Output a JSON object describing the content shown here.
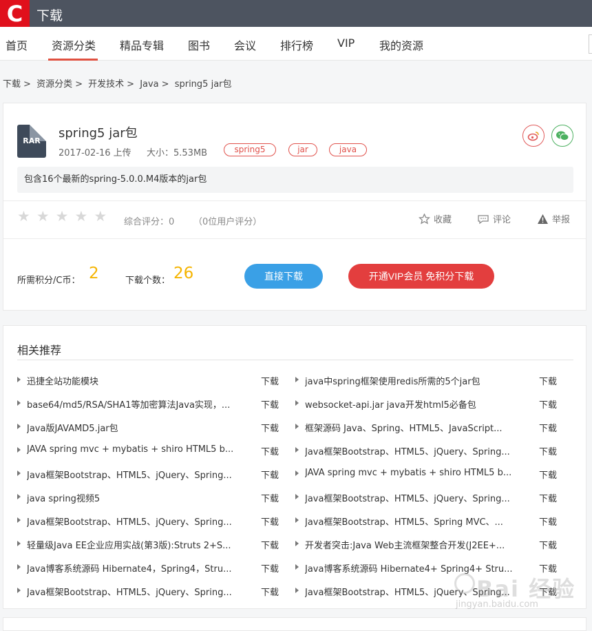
{
  "header": {
    "logo_letter": "C",
    "title": "下载"
  },
  "nav": {
    "items": [
      "首页",
      "资源分类",
      "精品专辑",
      "图书",
      "会议",
      "排行榜",
      "VIP",
      "我的资源"
    ],
    "active": "资源分类"
  },
  "breadcrumb": [
    "下载",
    ">",
    "资源分类",
    ">",
    "开发技术",
    ">",
    "Java",
    ">",
    "spring5 jar包"
  ],
  "resource": {
    "file_type": "RAR",
    "title": "spring5 jar包",
    "date": "2017-02-16 上传",
    "size": "大小：5.53MB",
    "tags": [
      "spring5",
      "jar",
      "java"
    ],
    "description": "包含16个最新的spring-5.0.0.M4版本的jar包",
    "rating_label": "综合评分：0",
    "rating_users": "（0位用户评分）",
    "star_count": 5,
    "actions": {
      "favorite": "收藏",
      "comment": "评论",
      "report": "举报"
    },
    "points_label": "所需积分/C币：",
    "points_value": "2",
    "downloads_label": "下载个数：",
    "downloads_value": "26",
    "download_button": "直接下载",
    "vip_button": "开通VIP会员 免积分下载"
  },
  "colors": {
    "brand_red": "#e0101c",
    "accent_blue": "#3aa0e6",
    "accent_red": "#e33e3e",
    "points_yellow": "#f5b400"
  },
  "related": {
    "title": "相关推荐",
    "download_label": "下载",
    "left": [
      "迅捷全站功能模块",
      "base64/md5/RSA/SHA1等加密算法Java实现，...",
      "Java版JAVAMD5.jar包",
      "JAVA spring mvc + mybatis + shiro HTML5 b...",
      "Java框架Bootstrap、HTML5、jQuery、Spring...",
      "java spring视频5",
      "Java框架Bootstrap、HTML5、jQuery、Spring...",
      "轻量级Java EE企业应用实战(第3版):Struts 2+S...",
      "Java博客系统源码 Hibernate4，Spring4，Stru...",
      "Java框架Bootstrap、HTML5、jQuery、Spring..."
    ],
    "right": [
      "java中spring框架使用redis所需的5个jar包",
      "websocket-api.jar java开发html5必备包",
      "框架源码 Java、Spring、HTML5、JavaScript...",
      "Java框架Bootstrap、HTML5、jQuery、Spring...",
      "JAVA spring mvc + mybatis + shiro HTML5 b...",
      "Java框架Bootstrap、HTML5、jQuery、Spring...",
      "Java框架Bootstrap、HTML5、Spring MVC、...",
      "开发者突击:Java Web主流框架整合开发(J2EE+...",
      "Java博客系统源码 Hibernate4+ Spring4+ Stru...",
      "Java框架Bootstrap、HTML5、jQuery、Spring..."
    ]
  },
  "watermark": {
    "text": "Bai 经验",
    "sub": "jingyan.baidu.com"
  }
}
